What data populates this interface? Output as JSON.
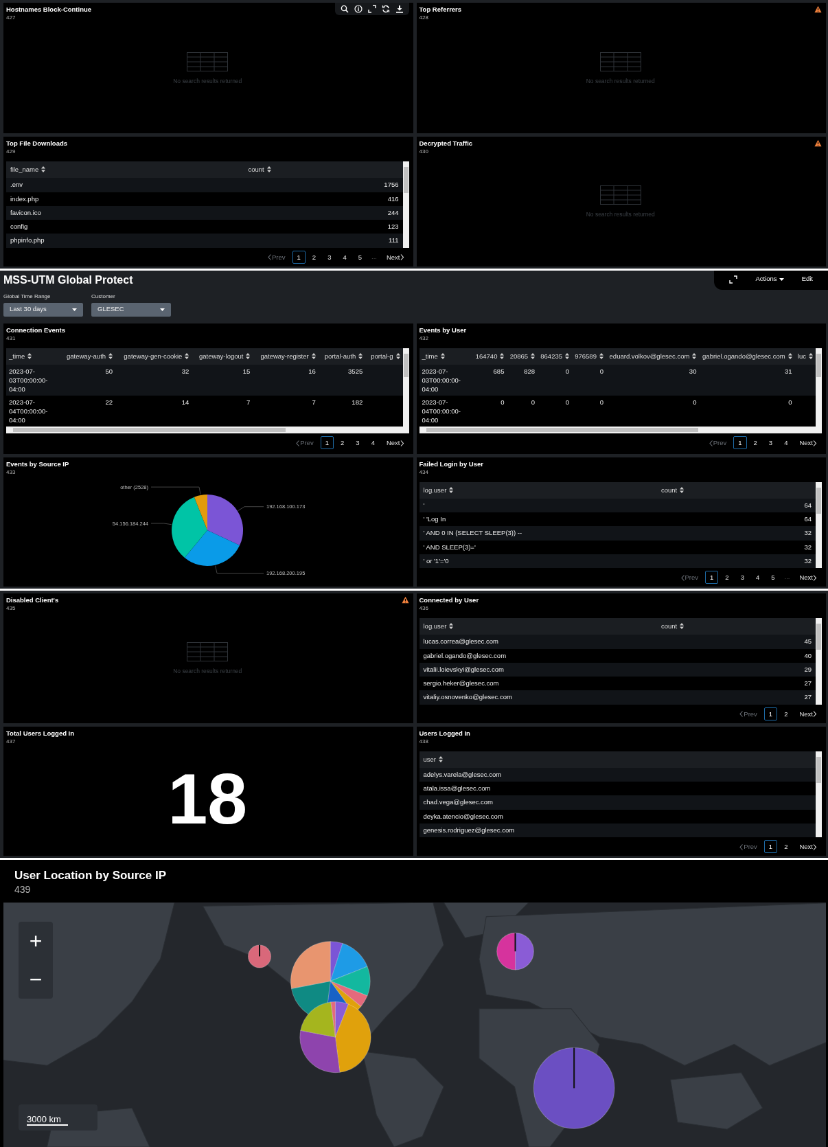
{
  "sections": [
    {
      "kind": "panels",
      "panels": [
        {
          "kind": "empty",
          "title": "Hostnames Block-Continue",
          "id": "427",
          "warning": false,
          "hovered": true,
          "message": "No search results returned"
        },
        {
          "kind": "empty",
          "title": "Top Referrers",
          "id": "428",
          "warning": true,
          "hovered": false,
          "message": "No search results returned"
        },
        {
          "kind": "table",
          "title": "Top File Downloads",
          "id": "429",
          "warning": false,
          "hovered": false,
          "table": {
            "horizontal_scroll": false,
            "columns": [
              {
                "label": "file_name",
                "numeric": false
              },
              {
                "label": "count",
                "numeric": true
              }
            ],
            "rows": [
              [
                ".env",
                "1756"
              ],
              [
                "index.php",
                "416"
              ],
              [
                "favicon.ico",
                "244"
              ],
              [
                "config",
                "123"
              ],
              [
                "phpinfo.php",
                "111"
              ]
            ],
            "pagination": {
              "prev": "Prev",
              "prev_disabled": true,
              "pages": [
                {
                  "label": "1",
                  "selected": true
                },
                {
                  "label": "2",
                  "selected": false
                },
                {
                  "label": "3",
                  "selected": false
                },
                {
                  "label": "4",
                  "selected": false
                },
                {
                  "label": "5",
                  "selected": false
                }
              ],
              "ellipsis": "...",
              "next": "Next"
            }
          }
        },
        {
          "kind": "empty",
          "title": "Decrypted Traffic",
          "id": "430",
          "warning": true,
          "hovered": false,
          "message": "No search results returned"
        }
      ]
    },
    {
      "kind": "dashboard",
      "header": {
        "title": "MSS-UTM Global Protect",
        "inputs": [
          {
            "label": "Global Time Range",
            "value": "Last 30 days"
          },
          {
            "label": "Customer",
            "value": "GLESEC"
          }
        ],
        "actions": "Actions",
        "edit": "Edit"
      },
      "panels": [
        {
          "kind": "table",
          "title": "Connection Events",
          "id": "431",
          "warning": false,
          "hovered": false,
          "table": {
            "horizontal_scroll": true,
            "columns": [
              {
                "label": "_time",
                "numeric": false
              },
              {
                "label": "gateway-auth",
                "numeric": true
              },
              {
                "label": "gateway-gen-cookie",
                "numeric": true
              },
              {
                "label": "gateway-logout",
                "numeric": true
              },
              {
                "label": "gateway-register",
                "numeric": true
              },
              {
                "label": "portal-auth",
                "numeric": true
              },
              {
                "label": "portal-g",
                "numeric": true
              }
            ],
            "rows": [
              [
                "2023-07-03T00:00:00-04:00",
                "50",
                "32",
                "15",
                "16",
                "3525"
              ],
              [
                "2023-07-04T00:00:00-04:00",
                "22",
                "14",
                "7",
                "7",
                "182"
              ]
            ],
            "pagination": {
              "prev": "Prev",
              "prev_disabled": true,
              "pages": [
                {
                  "label": "1",
                  "selected": true
                },
                {
                  "label": "2",
                  "selected": false
                },
                {
                  "label": "3",
                  "selected": false
                },
                {
                  "label": "4",
                  "selected": false
                }
              ],
              "next": "Next"
            }
          }
        },
        {
          "kind": "table",
          "title": "Events by User",
          "id": "432",
          "warning": false,
          "hovered": false,
          "table": {
            "horizontal_scroll": true,
            "columns": [
              {
                "label": "_time",
                "numeric": false
              },
              {
                "label": "164740",
                "numeric": true
              },
              {
                "label": "20865",
                "numeric": true
              },
              {
                "label": "864235",
                "numeric": true
              },
              {
                "label": "976589",
                "numeric": true
              },
              {
                "label": "eduard.volkov@glesec.com",
                "numeric": true
              },
              {
                "label": "gabriel.ogando@glesec.com",
                "numeric": true
              },
              {
                "label": "luc",
                "numeric": true
              }
            ],
            "rows": [
              [
                "2023-07-03T00:00:00-04:00",
                "685",
                "828",
                "0",
                "0",
                "30",
                "31"
              ],
              [
                "2023-07-04T00:00:00-04:00",
                "0",
                "0",
                "0",
                "0",
                "0",
                "0"
              ]
            ],
            "pagination": {
              "prev": "Prev",
              "prev_disabled": true,
              "pages": [
                {
                  "label": "1",
                  "selected": true
                },
                {
                  "label": "2",
                  "selected": false
                },
                {
                  "label": "3",
                  "selected": false
                },
                {
                  "label": "4",
                  "selected": false
                }
              ],
              "next": "Next"
            }
          }
        },
        {
          "kind": "pie",
          "title": "Events by Source IP",
          "id": "433",
          "warning": false,
          "hovered": false,
          "chart_data": {
            "type": "pie",
            "categories": [
              "192.168.100.173",
              "192.168.200.195",
              "54.156.184.244",
              "other (2528)"
            ],
            "values": [
              32,
              29,
              33,
              6
            ]
          }
        },
        {
          "kind": "table",
          "title": "Failed Login by User",
          "id": "434",
          "warning": false,
          "hovered": false,
          "table": {
            "horizontal_scroll": false,
            "columns": [
              {
                "label": "log.user",
                "numeric": false
              },
              {
                "label": "count",
                "numeric": true
              }
            ],
            "rows": [
              [
                "'",
                "64"
              ],
              [
                "' 'Log In",
                "64"
              ],
              [
                "' AND 0 IN (SELECT SLEEP(3)) --",
                "32"
              ],
              [
                "' AND SLEEP(3)='",
                "32"
              ],
              [
                "' or '1'='0",
                "32"
              ]
            ],
            "pagination": {
              "prev": "Prev",
              "prev_disabled": true,
              "pages": [
                {
                  "label": "1",
                  "selected": true
                },
                {
                  "label": "2",
                  "selected": false
                },
                {
                  "label": "3",
                  "selected": false
                },
                {
                  "label": "4",
                  "selected": false
                },
                {
                  "label": "5",
                  "selected": false
                }
              ],
              "ellipsis": "...",
              "next": "Next"
            }
          }
        }
      ]
    },
    {
      "kind": "panels",
      "panels": [
        {
          "kind": "empty",
          "title": "Disabled Client's",
          "id": "435",
          "warning": true,
          "hovered": false,
          "message": "No search results returned"
        },
        {
          "kind": "table",
          "title": "Connected by User",
          "id": "436",
          "warning": false,
          "hovered": false,
          "table": {
            "horizontal_scroll": false,
            "columns": [
              {
                "label": "log.user",
                "numeric": false
              },
              {
                "label": "count",
                "numeric": true
              }
            ],
            "rows": [
              [
                "lucas.correa@glesec.com",
                "45"
              ],
              [
                "gabriel.ogando@glesec.com",
                "40"
              ],
              [
                "vitalii.loievskyi@glesec.com",
                "29"
              ],
              [
                "sergio.heker@glesec.com",
                "27"
              ],
              [
                "vitaliy.osnovenko@glesec.com",
                "27"
              ]
            ],
            "pagination": {
              "prev": "Prev",
              "prev_disabled": true,
              "pages": [
                {
                  "label": "1",
                  "selected": true
                },
                {
                  "label": "2",
                  "selected": false
                }
              ],
              "next": "Next"
            }
          }
        },
        {
          "kind": "single",
          "title": "Total Users Logged In",
          "id": "437",
          "warning": false,
          "hovered": false,
          "value": "18"
        },
        {
          "kind": "table",
          "title": "Users Logged In",
          "id": "438",
          "warning": false,
          "hovered": false,
          "table": {
            "horizontal_scroll": false,
            "columns": [
              {
                "label": "user",
                "numeric": false
              }
            ],
            "rows": [
              [
                "adelys.varela@glesec.com"
              ],
              [
                "atala.issa@glesec.com"
              ],
              [
                "chad.vega@glesec.com"
              ],
              [
                "deyka.atencio@glesec.com"
              ],
              [
                "genesis.rodriguez@glesec.com"
              ]
            ],
            "pagination": {
              "prev": "Prev",
              "prev_disabled": true,
              "pages": [
                {
                  "label": "1",
                  "selected": true
                },
                {
                  "label": "2",
                  "selected": false
                }
              ],
              "next": "Next"
            }
          }
        }
      ]
    },
    {
      "kind": "panels",
      "panels": [
        {
          "kind": "map",
          "title": "User Location by Source IP",
          "id": "439",
          "zoom_in": "+",
          "zoom_out": "−",
          "scale": "3000 km"
        }
      ]
    }
  ]
}
